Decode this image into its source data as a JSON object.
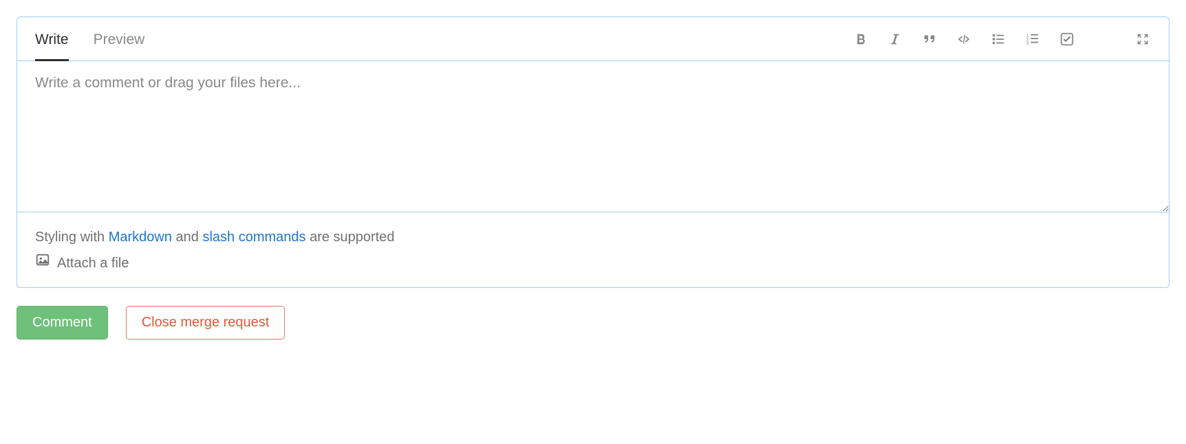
{
  "editor": {
    "tabs": {
      "write": "Write",
      "preview": "Preview"
    },
    "placeholder": "Write a comment or drag your files here...",
    "value": ""
  },
  "hints": {
    "prefix": "Styling with ",
    "markdown_link": "Markdown",
    "middle": " and ",
    "slash_link": "slash commands",
    "suffix": " are supported",
    "attach_label": "Attach a file"
  },
  "buttons": {
    "comment": "Comment",
    "close_mr": "Close merge request"
  }
}
